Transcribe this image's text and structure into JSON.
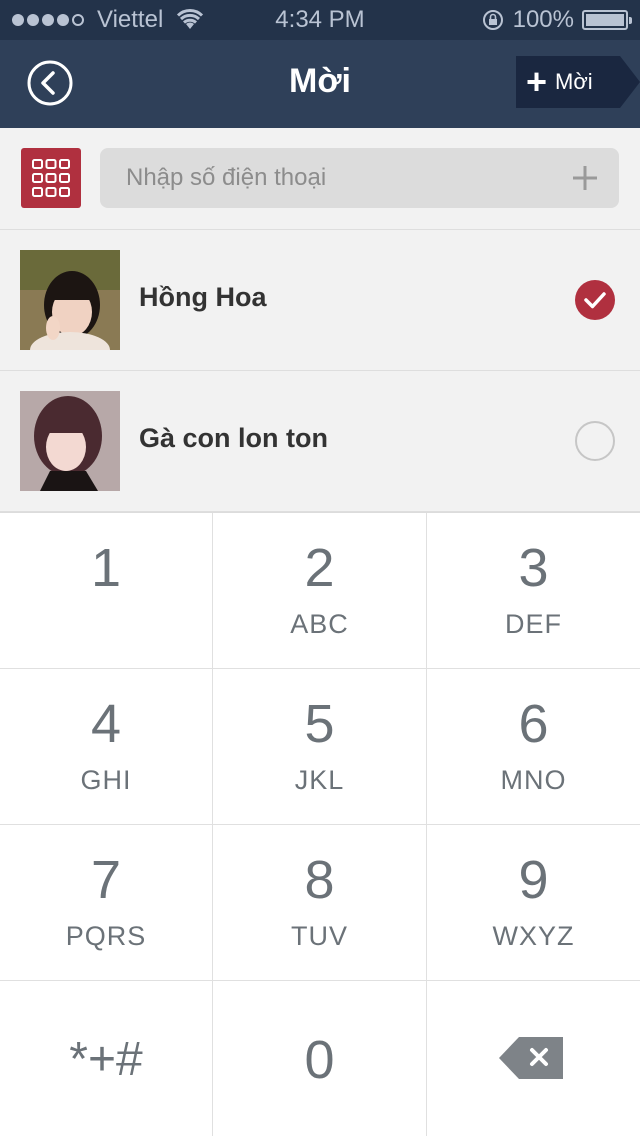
{
  "status_bar": {
    "carrier": "Viettel",
    "time": "4:34 PM",
    "battery": "100%",
    "battery_level": 1.0,
    "signal_bars": 4,
    "signal_total": 5
  },
  "nav": {
    "title": "Mời",
    "invite_label": "Mời",
    "invite_plus": "+"
  },
  "search": {
    "placeholder": "Nhập số điện thoại"
  },
  "contacts": [
    {
      "name": "Hồng Hoa",
      "selected": true
    },
    {
      "name": "Gà con lon ton",
      "selected": false
    }
  ],
  "keypad": {
    "keys": [
      {
        "digit": "1",
        "letters": ""
      },
      {
        "digit": "2",
        "letters": "ABC"
      },
      {
        "digit": "3",
        "letters": "DEF"
      },
      {
        "digit": "4",
        "letters": "GHI"
      },
      {
        "digit": "5",
        "letters": "JKL"
      },
      {
        "digit": "6",
        "letters": "MNO"
      },
      {
        "digit": "7",
        "letters": "PQRS"
      },
      {
        "digit": "8",
        "letters": "TUV"
      },
      {
        "digit": "9",
        "letters": "WXYZ"
      }
    ],
    "symbols": "*+#",
    "zero": "0"
  },
  "colors": {
    "status_bar": "#23334a",
    "nav_bar": "#2f4059",
    "accent": "#b0303f",
    "background": "#f2f2f2"
  }
}
